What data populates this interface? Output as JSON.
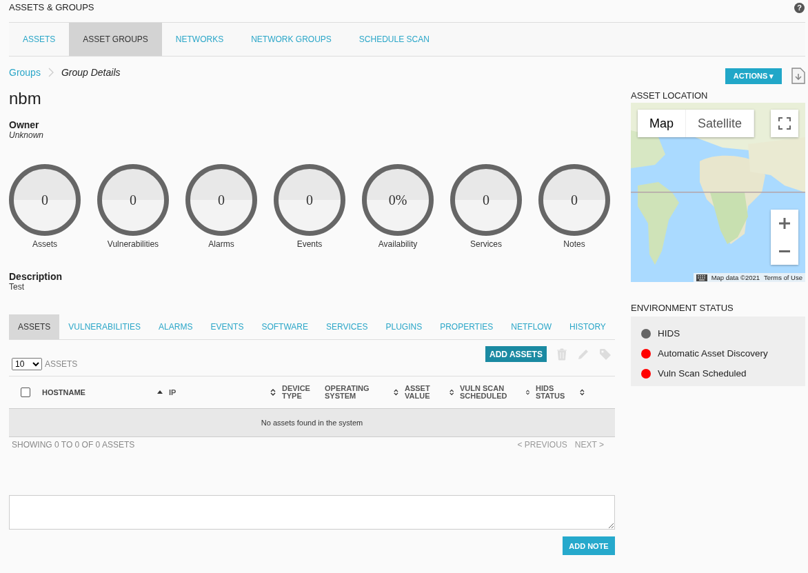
{
  "header": {
    "title": "ASSETS & GROUPS",
    "help_icon": "?"
  },
  "tabs": [
    {
      "label": "ASSETS",
      "selected": false
    },
    {
      "label": "ASSET GROUPS",
      "selected": true
    },
    {
      "label": "NETWORKS",
      "selected": false
    },
    {
      "label": "NETWORK GROUPS",
      "selected": false
    },
    {
      "label": "SCHEDULE SCAN",
      "selected": false
    }
  ],
  "breadcrumb": {
    "link": "Groups",
    "current": "Group Details"
  },
  "group": {
    "name": "nbm",
    "owner_label": "Owner",
    "owner": "Unknown",
    "description_label": "Description",
    "description": "Test"
  },
  "stats": [
    {
      "value": "0",
      "label": "Assets"
    },
    {
      "value": "0",
      "label": "Vulnerabilities"
    },
    {
      "value": "0",
      "label": "Alarms"
    },
    {
      "value": "0",
      "label": "Events"
    },
    {
      "value": "0%",
      "label": "Availability"
    },
    {
      "value": "0",
      "label": "Services"
    },
    {
      "value": "0",
      "label": "Notes"
    }
  ],
  "detail_tabs": [
    {
      "label": "ASSETS",
      "selected": true
    },
    {
      "label": "VULNERABILITIES",
      "selected": false
    },
    {
      "label": "ALARMS",
      "selected": false
    },
    {
      "label": "EVENTS",
      "selected": false
    },
    {
      "label": "SOFTWARE",
      "selected": false
    },
    {
      "label": "SERVICES",
      "selected": false
    },
    {
      "label": "PLUGINS",
      "selected": false
    },
    {
      "label": "PROPERTIES",
      "selected": false
    },
    {
      "label": "NETFLOW",
      "selected": false
    },
    {
      "label": "HISTORY",
      "selected": false
    }
  ],
  "assets_table": {
    "add_button": "ADD ASSETS",
    "page_size": "10",
    "page_size_label": "ASSETS",
    "columns": [
      {
        "label": "HOSTNAME",
        "sortable": true,
        "sorted": true
      },
      {
        "label": "IP",
        "sortable": true,
        "sorted": false
      },
      {
        "label": "DEVICE TYPE",
        "sortable": false,
        "sorted": false
      },
      {
        "label": "OPERATING SYSTEM",
        "sortable": true,
        "sorted": false
      },
      {
        "label": "ASSET VALUE",
        "sortable": true,
        "sorted": false
      },
      {
        "label": "VULN SCAN SCHEDULED",
        "sortable": true,
        "sorted": false
      },
      {
        "label": "HIDS STATUS",
        "sortable": true,
        "sorted": false
      }
    ],
    "select_all_checked": false,
    "empty_message": "No assets found in the system",
    "summary": "SHOWING 0 TO 0 OF 0 ASSETS",
    "pagination": [
      {
        "label": "< PREVIOUS",
        "disabled": true
      },
      {
        "label": "NEXT >",
        "disabled": true
      }
    ]
  },
  "notes": {
    "button": "ADD NOTE"
  },
  "actions_button": "ACTIONS ▾",
  "location": {
    "title": "ASSET LOCATION",
    "map_type": [
      {
        "label": "Map",
        "selected": true
      },
      {
        "label": "Satellite",
        "selected": false
      }
    ],
    "attribution": "Map data ©2021",
    "terms": "Terms of Use"
  },
  "environment": {
    "title": "ENVIRONMENT STATUS",
    "items": [
      {
        "label": "HIDS",
        "color": "#666666"
      },
      {
        "label": "Automatic Asset Discovery",
        "color": "#ff0000"
      },
      {
        "label": "Vuln Scan Scheduled",
        "color": "#ff0000"
      }
    ]
  }
}
